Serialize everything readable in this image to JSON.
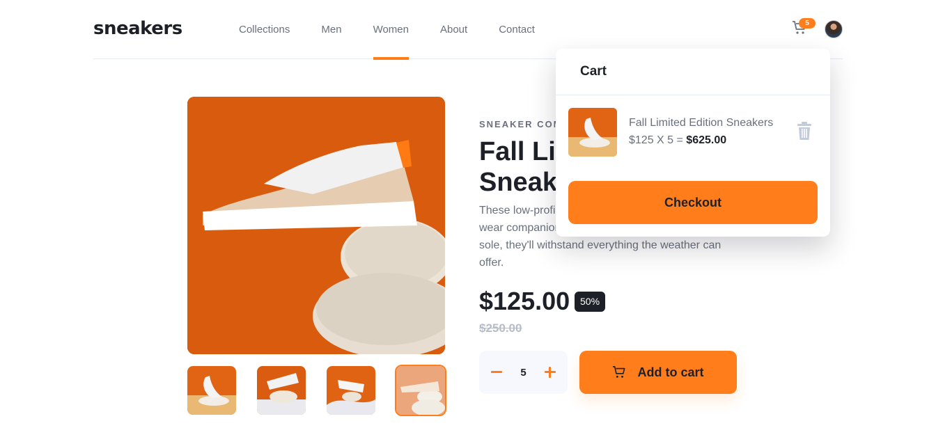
{
  "brand": {
    "logo": "sneakers"
  },
  "nav": {
    "items": [
      {
        "label": "Collections"
      },
      {
        "label": "Men"
      },
      {
        "label": "Women",
        "active": true
      },
      {
        "label": "About"
      },
      {
        "label": "Contact"
      }
    ]
  },
  "header": {
    "cart_count": "5",
    "cart_icon": "cart-icon",
    "avatar_icon": "avatar"
  },
  "product": {
    "company": "SNEAKER COMPANY",
    "title": "Fall Limited Edition Sneakers",
    "description": "These low-profile sneakers are your perfect casual wear companion. Featuring a durable rubber outer sole, they'll withstand everything the weather can offer.",
    "price": "$125.00",
    "discount": "50%",
    "old_price": "$250.00",
    "quantity": "5",
    "add_to_cart_label": "Add to cart",
    "thumbnails_count": 4,
    "active_thumbnail": 4
  },
  "cart": {
    "title": "Cart",
    "item_name": "Fall Limited Edition Sneakers",
    "item_calc": "$125 X 5 = ",
    "item_total": "$625.00",
    "checkout_label": "Checkout"
  },
  "colors": {
    "accent": "#ff7e1b",
    "dark": "#1d2026",
    "muted": "#69707d",
    "light_bg": "#f6f8fd"
  }
}
